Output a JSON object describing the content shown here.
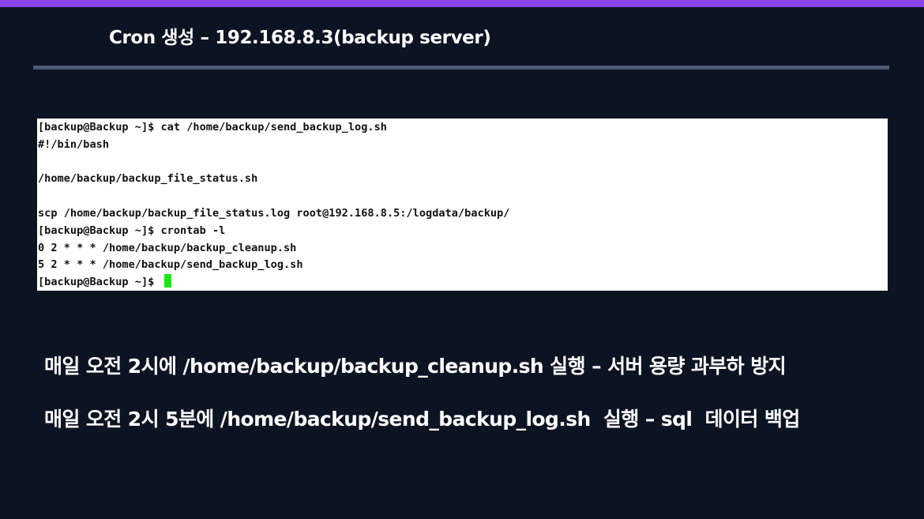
{
  "slide": {
    "title": "Cron 생성 – 192.168.8.3(backup server)",
    "accent_color": "#8b45e8",
    "background_color": "#0c1423",
    "rule_color": "#4b5a76"
  },
  "terminal": {
    "lines": [
      "[backup@Backup ~]$ cat /home/backup/send_backup_log.sh",
      "#!/bin/bash",
      "",
      "/home/backup/backup_file_status.sh",
      "",
      "scp /home/backup/backup_file_status.log root@192.168.8.5:/logdata/backup/",
      "[backup@Backup ~]$ crontab -l",
      "0 2 * * * /home/backup/backup_cleanup.sh",
      "5 2 * * * /home/backup/send_backup_log.sh",
      "[backup@Backup ~]$ "
    ],
    "cursor_color": "#19e619"
  },
  "descriptions": [
    "매일 오전 2시에 /home/backup/backup_cleanup.sh 실행 – 서버 용량 과부하 방지",
    "매일 오전 2시 5분에 /home/backup/send_backup_log.sh  실행 – sql  데이터 백업"
  ]
}
